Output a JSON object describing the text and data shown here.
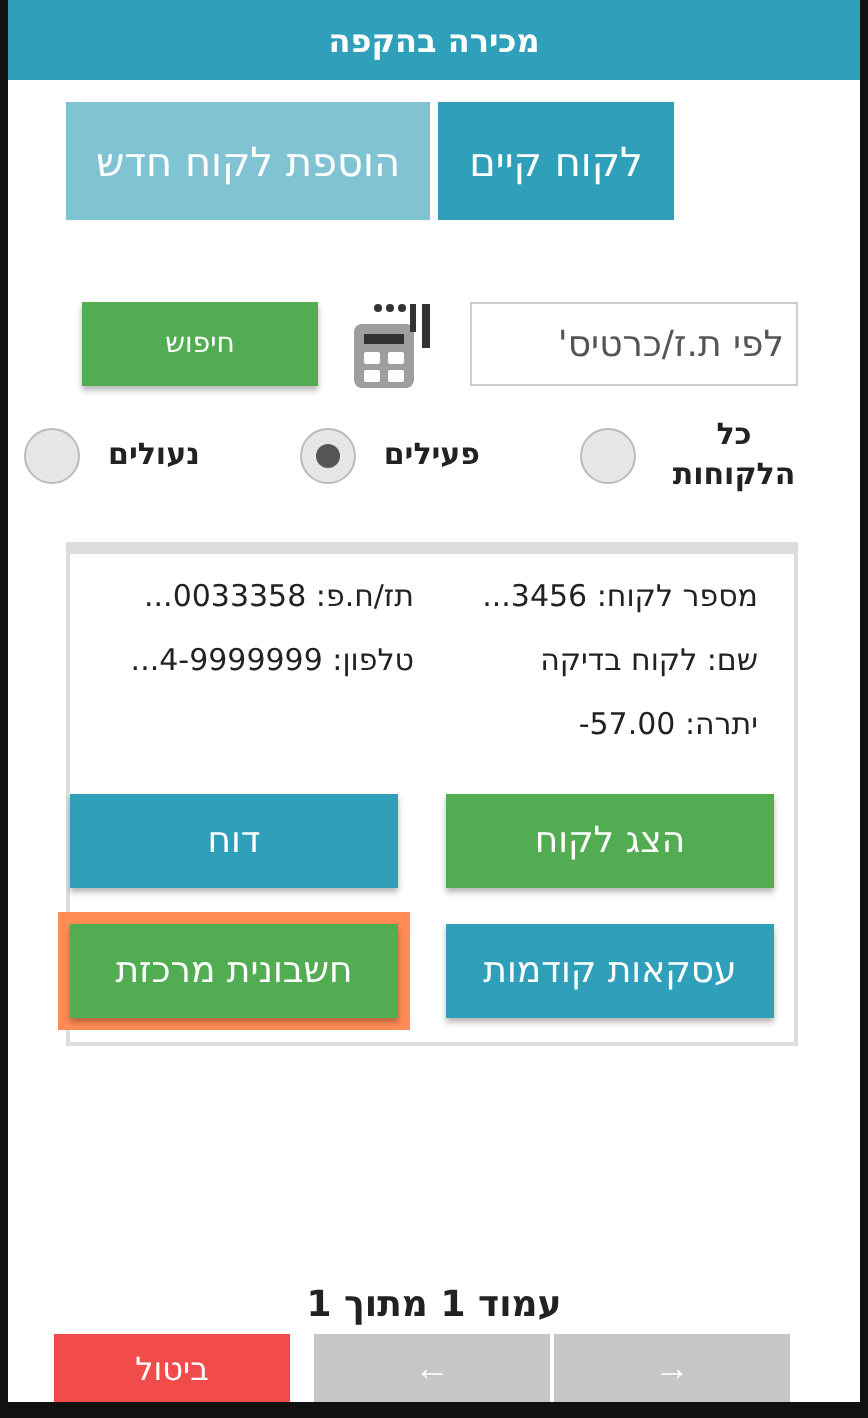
{
  "header": {
    "title": "מכירה בהקפה"
  },
  "tabs": [
    {
      "label": "לקוח קיים",
      "selected": true
    },
    {
      "label": "הוספת לקוח חדש",
      "selected": false
    }
  ],
  "search": {
    "placeholder": "לפי ת.ז/כרטיס'",
    "button": "חיפוש"
  },
  "filters": [
    {
      "label": "כל הלקוחות",
      "selected": false
    },
    {
      "label": "פעילים",
      "selected": true
    },
    {
      "label": "נעולים",
      "selected": false
    }
  ],
  "customer": {
    "fields": [
      {
        "text": "מספר לקוח: 3456..."
      },
      {
        "text": "תז/ח.פ: 0033358..."
      },
      {
        "text": "שם: לקוח בדיקה"
      },
      {
        "text": "טלפון: 4-9999999..."
      },
      {
        "text": "יתרה: 57.00-"
      }
    ],
    "actions": [
      {
        "label": "הצג לקוח",
        "kind": "green",
        "focused": false
      },
      {
        "label": "דוח",
        "kind": "teal",
        "focused": false
      },
      {
        "label": "עסקאות קודמות",
        "kind": "teal",
        "focused": false
      },
      {
        "label": "חשבונית מרכזת",
        "kind": "green",
        "focused": true
      }
    ]
  },
  "pager": {
    "text": "עמוד 1 מתוך 1",
    "next": "→",
    "prev": "←"
  },
  "cancel": "ביטול"
}
